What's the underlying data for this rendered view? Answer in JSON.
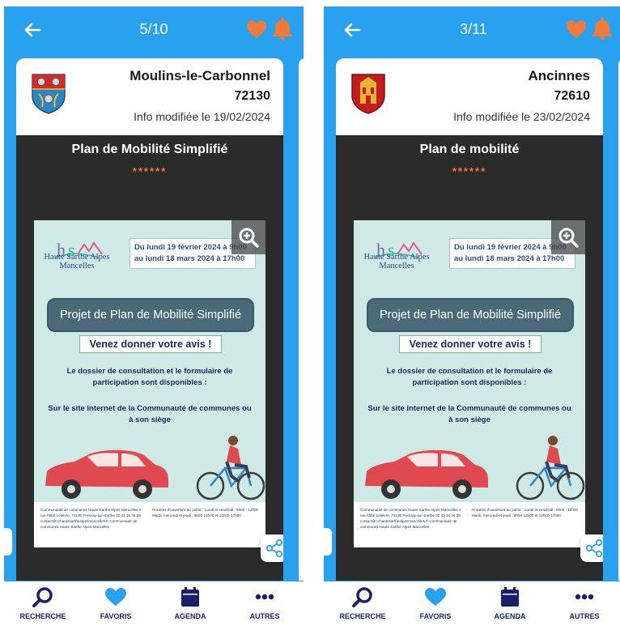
{
  "screens": [
    {
      "counter": "5/10",
      "town": "Moulins-le-Carbonnel",
      "postcode": "72130",
      "modified": "Info modifiée le 19/02/2024",
      "plan_title": "Plan de Mobilité Simplifié",
      "stars": "******",
      "poster": {
        "logo_name": "Haute Sarthe Alpes Mancelles",
        "dates_line1": "Du lundi 19 février 2024 à 9h00",
        "dates_line2": "au lundi 18 mars 2024 à 17h00",
        "project": "Projet de Plan de Mobilité Simplifié",
        "opinion": "Venez donner votre avis !",
        "text1": "Le dossier de consultation et le formulaire de participation sont disponibles :",
        "text2": "Sur le site internet de la Communauté de communes ou à son siège",
        "footer_left": "Communauté de communes Haute Sarthe Alpes Mancelles 2 rue Abbé Lelièvre, 72130 Fresnay-sur-Sarthe 02 43 34 34 39 contact@cchautesarthealpesmancelles.fr Communauté de communes Haute Sarthe Alpes Mancelles",
        "footer_right": "Horaires d'ouverture au public : Lundi et vendredi : 9h00 - 12h00 Mardi, mercredi et jeudi : 9h00-12h00 et 14h00-17h00"
      }
    },
    {
      "counter": "3/11",
      "town": "Ancinnes",
      "postcode": "72610",
      "modified": "Info modifiée le 23/02/2024",
      "plan_title": "Plan de mobilité",
      "stars": "******",
      "poster": {
        "logo_name": "Haute Sarthe Alpes Mancelles",
        "dates_line1": "Du lundi 19 février 2024 à 9h00",
        "dates_line2": "au lundi 18 mars 2024 à 17h00",
        "project": "Projet de Plan de Mobilité Simplifié",
        "opinion": "Venez donner votre avis !",
        "text1": "Le dossier de consultation et le formulaire de participation sont disponibles :",
        "text2": "Sur le site internet de la Communauté de communes ou à son siège",
        "footer_left": "Communauté de communes Haute Sarthe Alpes Mancelles 2 rue Abbé Lelièvre, 72130 Fresnay-sur-Sarthe 02 43 34 34 39 contact@cchautesarthealpesmancelles.fr Communauté de communes Haute Sarthe Alpes Mancelles",
        "footer_right": "Horaires d'ouverture au public : Lundi et vendredi : 9h00 - 12h00 Mardi, mercredi et jeudi : 9h00-12h00 et 14h00-17h00"
      }
    }
  ],
  "nav": {
    "search": "RECHERCHE",
    "favorites": "FAVORIS",
    "agenda": "AGENDA",
    "others": "AUTRES"
  },
  "colors": {
    "primary": "#2aa1ee",
    "accent": "#f07a3a",
    "nav_text": "#1a1f6b",
    "card_bg": "#2b2b2b"
  },
  "icons": [
    "back-arrow-icon",
    "heart-icon",
    "bell-icon",
    "zoom-in-icon",
    "share-icon",
    "search-icon",
    "calendar-icon",
    "more-icon"
  ]
}
